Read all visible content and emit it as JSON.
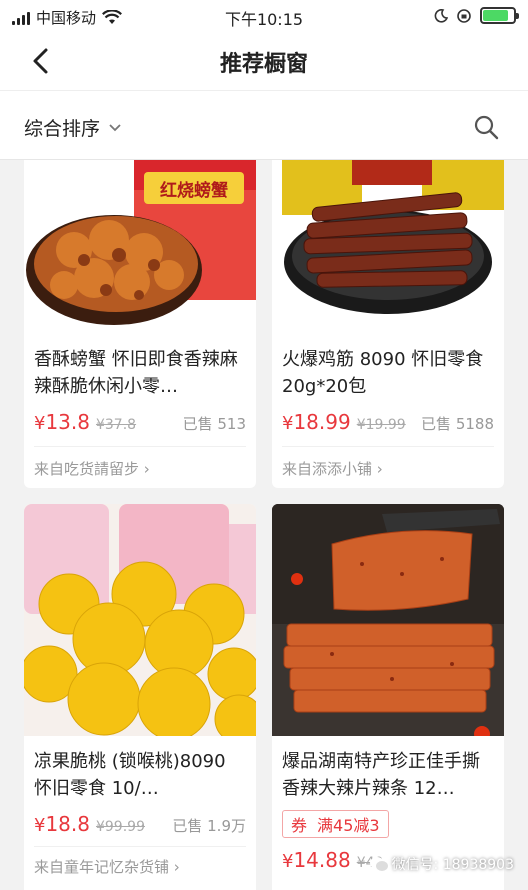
{
  "status_bar": {
    "carrier": "中国移动",
    "time": "下午10:15"
  },
  "nav": {
    "title": "推荐橱窗",
    "back_icon": "chevron-left-icon"
  },
  "sort_bar": {
    "sort_label": "综合排序",
    "search_icon": "search-icon"
  },
  "products": [
    {
      "name": "香酥螃蟹 怀旧即食香辣麻辣酥脆休闲小零…",
      "price_symbol": "¥",
      "price": "13.8",
      "old_price": "¥37.8",
      "sold": "已售 513",
      "shop": "来自吃货請留步 ›",
      "package_label": "红烧螃蟹"
    },
    {
      "name": "火爆鸡筋 8090 怀旧零食 20g*20包",
      "price_symbol": "¥",
      "price": "18.99",
      "old_price": "¥19.99",
      "sold": "已售 5188",
      "shop": "来自添添小铺 ›"
    },
    {
      "name": "凉果脆桃 (锁喉桃)8090 怀旧零食 10/…",
      "price_symbol": "¥",
      "price": "18.8",
      "old_price": "¥99.99",
      "sold": "已售 1.9万",
      "shop": "来自童年记忆杂货铺 ›"
    },
    {
      "name": "爆品湖南特产珍正佳手撕香辣大辣片辣条 12…",
      "coupon_tag": "券",
      "coupon_text": "满45减3",
      "price_symbol": "¥",
      "price": "14.88",
      "old_price": "¥40",
      "sold": ""
    }
  ],
  "watermark": "微信号: 18938903"
}
